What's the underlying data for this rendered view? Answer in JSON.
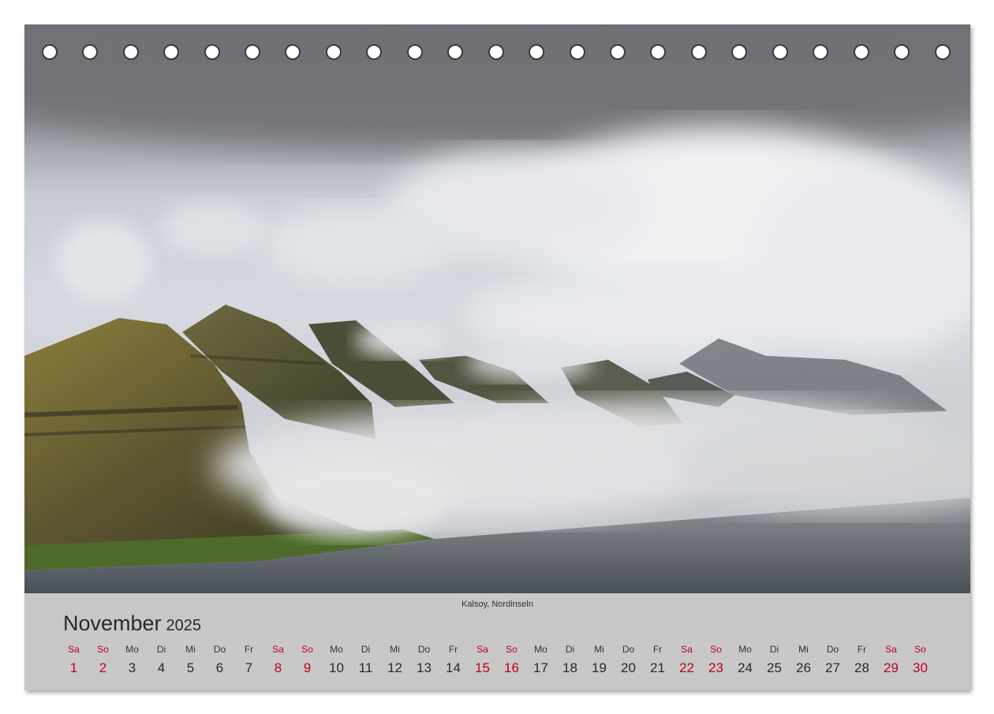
{
  "photo": {
    "caption": "Kalsoy, Nordinseln",
    "subject": "Mountain ridges rising from fog over the sea under a cloudy sky"
  },
  "calendar": {
    "month": "November",
    "year": "2025",
    "weekend_color": "#c0001a",
    "text_color": "#2a2a2a",
    "days": [
      {
        "name": "Sa",
        "num": "1",
        "weekend": true
      },
      {
        "name": "So",
        "num": "2",
        "weekend": true
      },
      {
        "name": "Mo",
        "num": "3",
        "weekend": false
      },
      {
        "name": "Di",
        "num": "4",
        "weekend": false
      },
      {
        "name": "Mi",
        "num": "5",
        "weekend": false
      },
      {
        "name": "Do",
        "num": "6",
        "weekend": false
      },
      {
        "name": "Fr",
        "num": "7",
        "weekend": false
      },
      {
        "name": "Sa",
        "num": "8",
        "weekend": true
      },
      {
        "name": "So",
        "num": "9",
        "weekend": true
      },
      {
        "name": "Mo",
        "num": "10",
        "weekend": false
      },
      {
        "name": "Di",
        "num": "11",
        "weekend": false
      },
      {
        "name": "Mi",
        "num": "12",
        "weekend": false
      },
      {
        "name": "Do",
        "num": "13",
        "weekend": false
      },
      {
        "name": "Fr",
        "num": "14",
        "weekend": false
      },
      {
        "name": "Sa",
        "num": "15",
        "weekend": true
      },
      {
        "name": "So",
        "num": "16",
        "weekend": true
      },
      {
        "name": "Mo",
        "num": "17",
        "weekend": false
      },
      {
        "name": "Di",
        "num": "18",
        "weekend": false
      },
      {
        "name": "Mi",
        "num": "19",
        "weekend": false
      },
      {
        "name": "Do",
        "num": "20",
        "weekend": false
      },
      {
        "name": "Fr",
        "num": "21",
        "weekend": false
      },
      {
        "name": "Sa",
        "num": "22",
        "weekend": true
      },
      {
        "name": "So",
        "num": "23",
        "weekend": true
      },
      {
        "name": "Mo",
        "num": "24",
        "weekend": false
      },
      {
        "name": "Di",
        "num": "25",
        "weekend": false
      },
      {
        "name": "Mi",
        "num": "26",
        "weekend": false
      },
      {
        "name": "Do",
        "num": "27",
        "weekend": false
      },
      {
        "name": "Fr",
        "num": "28",
        "weekend": false
      },
      {
        "name": "Sa",
        "num": "29",
        "weekend": true
      },
      {
        "name": "So",
        "num": "30",
        "weekend": true
      }
    ]
  }
}
